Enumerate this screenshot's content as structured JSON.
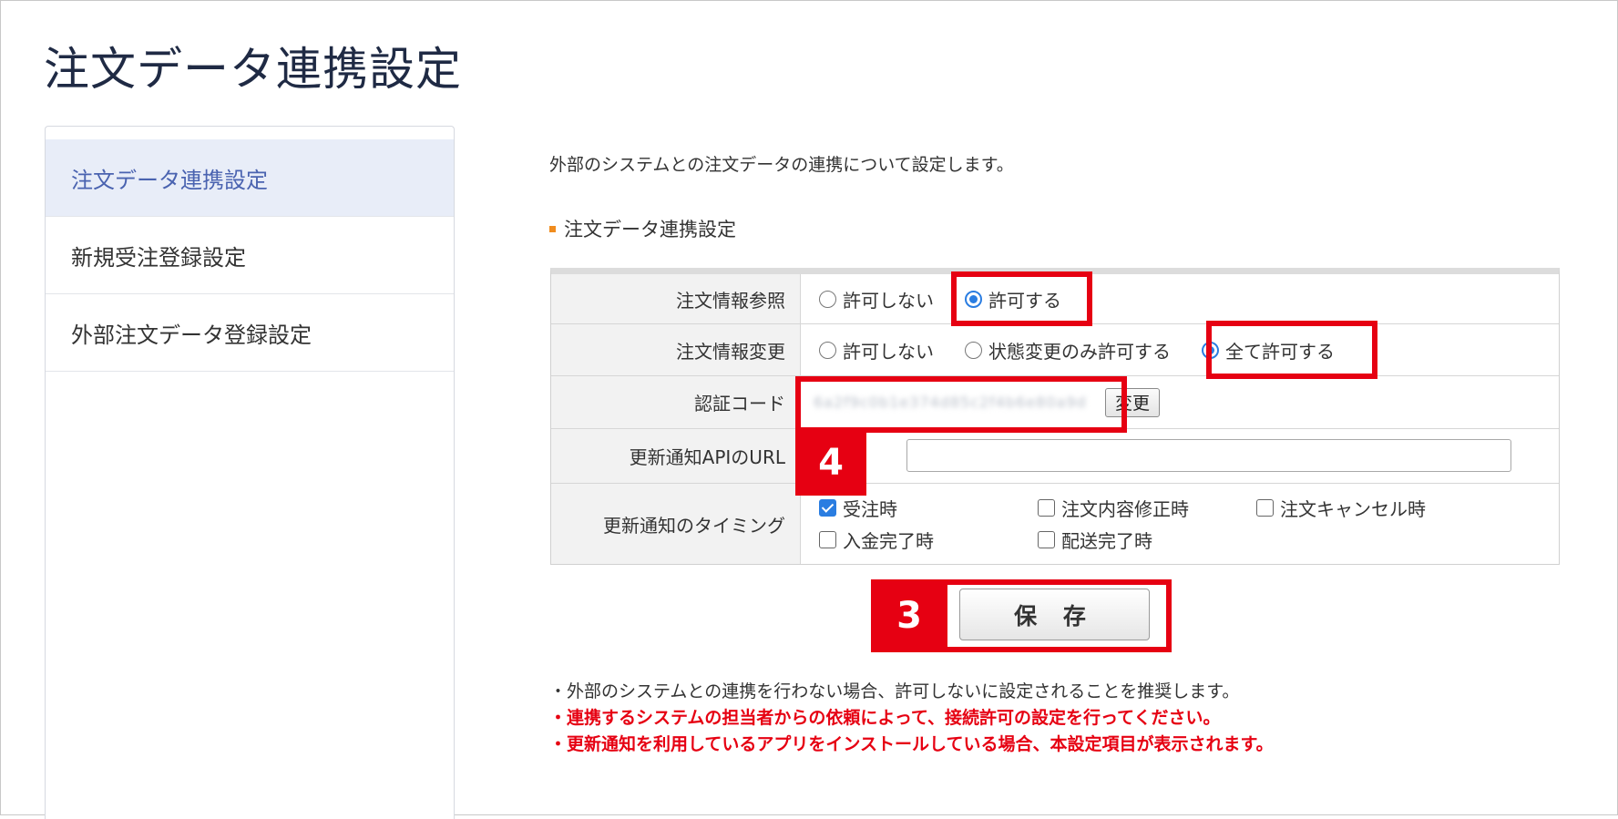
{
  "page": {
    "title": "注文データ連携設定"
  },
  "sidebar": {
    "items": [
      {
        "label": "注文データ連携設定",
        "active": true
      },
      {
        "label": "新規受注登録設定",
        "active": false
      },
      {
        "label": "外部注文データ登録設定",
        "active": false
      }
    ]
  },
  "main": {
    "intro": "外部のシステムとの注文データの連携について設定します。",
    "section_title": "注文データ連携設定",
    "order_read": {
      "label": "注文情報参照",
      "options": [
        "許可しない",
        "許可する"
      ],
      "selected": "許可する"
    },
    "order_write": {
      "label": "注文情報変更",
      "options": [
        "許可しない",
        "状態変更のみ許可する",
        "全て許可する"
      ],
      "selected": "全て許可する"
    },
    "auth_code": {
      "label": "認証コード",
      "value": "6a2f9c0b1e374d85c2f4b6e80a9d",
      "change_label": "変更"
    },
    "api_url": {
      "label": "更新通知APIのURL",
      "value": ""
    },
    "timing": {
      "label": "更新通知のタイミング",
      "options": [
        {
          "label": "受注時",
          "checked": true
        },
        {
          "label": "注文内容修正時",
          "checked": false
        },
        {
          "label": "注文キャンセル時",
          "checked": false
        },
        {
          "label": "入金完了時",
          "checked": false
        },
        {
          "label": "配送完了時",
          "checked": false
        }
      ]
    },
    "save_label": "保 存",
    "notes": [
      "・外部のシステムとの連携を行わない場合、許可しないに設定されることを推奨します。",
      "・連携するシステムの担当者からの依頼によって、接続許可の設定を行ってください。",
      "・更新通知を利用しているアプリをインストールしている場合、本設定項目が表示されます。"
    ]
  },
  "callouts": {
    "save_step": "3",
    "url_step": "4"
  },
  "colors": {
    "accent_blue": "#2a7de1",
    "highlight_red": "#e60012",
    "section_orange": "#f08c1e",
    "sidebar_active_bg": "#e8edf8"
  }
}
